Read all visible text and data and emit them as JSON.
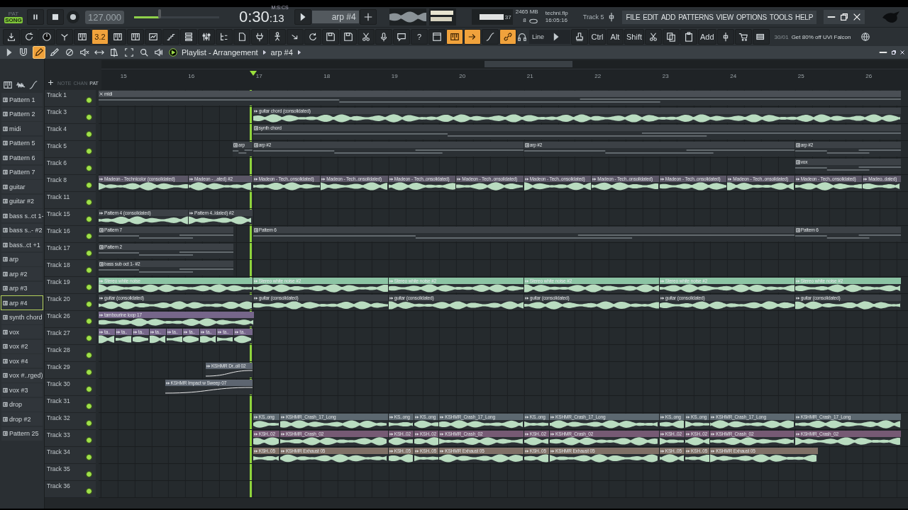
{
  "transport": {
    "modes": [
      {
        "label": "PAT",
        "selected": false
      },
      {
        "label": "SONG",
        "selected": true
      }
    ],
    "playing": true,
    "tempo": "127.000",
    "master_volume": {
      "level": 0.3
    },
    "time_format": "M:S:CS",
    "time": "0:30",
    "time_cs": ":13",
    "pattern": "arp #4"
  },
  "monitor": {
    "meter_reading": "37",
    "memory": "2465 MB",
    "cpu": "8",
    "file": "techni.flp",
    "clock": "16:05:16",
    "hint": "Track 5"
  },
  "menu": [
    "FILE",
    "EDIT",
    "ADD",
    "PATTERNS",
    "VIEW",
    "OPTIONS",
    "TOOLS",
    "HELP"
  ],
  "toolbar": {
    "buttons": [
      {
        "on": false
      },
      {
        "on": false
      },
      {
        "on": false
      },
      {
        "on": false
      },
      {
        "on": false
      },
      {
        "label": "3.2",
        "on": true
      },
      {
        "on": false
      },
      {
        "on": false
      },
      {
        "on": false
      },
      {
        "on": false
      },
      {
        "on": false
      },
      {
        "on": false
      },
      {
        "on": false
      },
      {
        "on": false
      },
      {
        "on": false
      },
      {
        "on": false
      },
      {
        "on": false
      },
      {
        "on": false
      },
      {
        "on": false
      },
      {
        "on": false
      },
      {
        "on": false
      },
      {
        "on": false
      },
      {
        "on": false
      },
      {
        "label": "?",
        "on": false
      },
      {
        "on": false
      },
      {
        "on": true
      },
      {
        "on": true
      },
      {
        "on": false
      },
      {
        "on": true
      }
    ],
    "snap_mode": "Line",
    "keys": [
      "Ctrl",
      "Alt",
      "Shift"
    ],
    "add": "Add",
    "news": {
      "date": "30/01",
      "text": "Get 80% off UVI Falcon"
    }
  },
  "playlist": {
    "tools": [
      {
        "on": false
      },
      {
        "on": true
      },
      {
        "on": false
      },
      {
        "on": false
      },
      {
        "on": false
      },
      {
        "on": false
      },
      {
        "on": false
      },
      {
        "on": false
      },
      {
        "on": false
      },
      {
        "on": false
      }
    ],
    "title": "Playlist - Arrangement",
    "pattern": "arp #4",
    "header_tabs": [
      {
        "label": "NOTE",
        "selected": false
      },
      {
        "label": "CHAN",
        "selected": false
      },
      {
        "label": "PAT",
        "selected": true
      }
    ],
    "ruler": [
      "15",
      "16",
      "17",
      "18",
      "19",
      "20",
      "21",
      "22",
      "23",
      "24",
      "25",
      "26"
    ]
  },
  "picker": [
    {
      "name": "Pattern 1",
      "selected": false
    },
    {
      "name": "Pattern 2",
      "selected": false
    },
    {
      "name": "midi",
      "selected": false
    },
    {
      "name": "Pattern 5",
      "selected": false
    },
    {
      "name": "Pattern 6",
      "selected": false
    },
    {
      "name": "Pattern 7",
      "selected": false
    },
    {
      "name": "guitar",
      "selected": false
    },
    {
      "name": "guitar #2",
      "selected": false
    },
    {
      "name": "bass s..ct 1-",
      "selected": false
    },
    {
      "name": "bass s..- #2",
      "selected": false
    },
    {
      "name": "bass..ct +1",
      "selected": false
    },
    {
      "name": "arp",
      "selected": false
    },
    {
      "name": "arp #2",
      "selected": false
    },
    {
      "name": "arp #3",
      "selected": false
    },
    {
      "name": "arp #4",
      "selected": true
    },
    {
      "name": "synth chord",
      "selected": false
    },
    {
      "name": "vox",
      "selected": false
    },
    {
      "name": "vox #2",
      "selected": false
    },
    {
      "name": "vox #4",
      "selected": false
    },
    {
      "name": "vox #..rged)",
      "selected": false
    },
    {
      "name": "vox #3",
      "selected": false
    },
    {
      "name": "drop",
      "selected": false
    },
    {
      "name": "drop #2",
      "selected": false
    },
    {
      "name": "Pattern 25",
      "selected": false
    }
  ],
  "tracks": [
    {
      "name": "Track 1",
      "enabled": true,
      "kind": "pattern",
      "color": "#4a4f55",
      "clips": [
        "midi"
      ]
    },
    {
      "name": "Track 3",
      "enabled": true,
      "kind": "audio",
      "color": "#3c4146",
      "clips": [
        "guitar chord (consolidated)"
      ]
    },
    {
      "name": "Track 4",
      "enabled": true,
      "kind": "pattern",
      "color": "#3c4146",
      "clips": [
        "synth chord"
      ]
    },
    {
      "name": "Track 5",
      "enabled": true,
      "kind": "pattern",
      "color": "#3c4146",
      "clips": [
        "arp",
        "arp #2",
        "arp #2",
        "arp #2"
      ]
    },
    {
      "name": "Track 6",
      "enabled": true,
      "kind": "pattern",
      "color": "#3c4146",
      "clips": [
        "vox"
      ]
    },
    {
      "name": "Track 8",
      "enabled": true,
      "kind": "audio",
      "color": "#5b5666",
      "clips": [
        "Madeon - Technicolor (consolidated)",
        "Madeon - ..ated) #2",
        "Madeon - Tech..onsolidated)",
        "Madeon - Tech..onsolidated)",
        "Madeon - Tech..onsolidated)",
        "Madeon - Tech..onsolidated)",
        "Madeon - Tech..onsolidated)",
        "Madeon - Tech..onsolidated)",
        "Madeon - Tech..onsolidated)",
        "Madeon - Tech..onsolidated)",
        "Madeon - Tech..onsolidated)",
        "Madeo..dated)"
      ]
    },
    {
      "name": "Track 11",
      "enabled": true
    },
    {
      "name": "Track 15",
      "enabled": true,
      "kind": "audio",
      "color": "#3c4146",
      "clips": [
        "Pattern 4 (consolidated)",
        "Pattern 4..idated) #2"
      ]
    },
    {
      "name": "Track 16",
      "enabled": true,
      "kind": "pattern",
      "color": "#3c4146",
      "clips": [
        "Pattern 7",
        "Pattern 6",
        "Pattern 6"
      ]
    },
    {
      "name": "Track 17",
      "enabled": true,
      "kind": "pattern",
      "color": "#3c4146",
      "clips": [
        "Pattern 2"
      ]
    },
    {
      "name": "Track 18",
      "enabled": true,
      "kind": "pattern",
      "color": "#3c4146",
      "clips": [
        "bass sub oct 1- #2"
      ]
    },
    {
      "name": "Track 19",
      "enabled": true,
      "kind": "audio",
      "color": "#8cc4a4",
      "clips": [
        "Stereo white noise",
        "Stereo white noise #2",
        "Stereo white noise #2",
        "Stereo white noise #2",
        "Stereo white noise #2",
        "Stereo white noise #2"
      ]
    },
    {
      "name": "Track 20",
      "enabled": true,
      "kind": "audio",
      "color": "#3c4146",
      "clips": [
        "guitar (consolidated)",
        "guitar (consolidated)",
        "guitar (consolidated)",
        "guitar (consolidated)",
        "guitar (consolidated)",
        "guitar (consolidated)"
      ]
    },
    {
      "name": "Track 26",
      "enabled": true,
      "kind": "audio",
      "color": "#76668a",
      "clips": [
        "tambourine loop 17"
      ]
    },
    {
      "name": "Track 27",
      "enabled": true,
      "kind": "audio",
      "color": "#76668a",
      "clips": [
        "ta..",
        "ta..",
        "ta..",
        "ta..",
        "ta..",
        "ta..",
        "ta..",
        "ta..",
        "ta.."
      ]
    },
    {
      "name": "Track 28",
      "enabled": true
    },
    {
      "name": "Track 29",
      "enabled": true,
      "kind": "automation",
      "color": "#5d6570",
      "clips": [
        "KSHMR Dr..oll 02"
      ]
    },
    {
      "name": "Track 30",
      "enabled": true,
      "kind": "automation",
      "color": "#5d6570",
      "clips": [
        "KSHMR Impact w Sweep 07"
      ]
    },
    {
      "name": "Track 31",
      "enabled": true
    },
    {
      "name": "Track 32",
      "enabled": true,
      "kind": "audio",
      "color": "#5c6870",
      "clips": [
        "KS..ong",
        "KSHMR_Crash_17_Long",
        "KS..ong",
        "KS..ong",
        "KSHMR_Crash_17_Long",
        "KS..ong",
        "KSHMR_Crash_17_Long",
        "KS..ong",
        "KS..ong",
        "KSHMR_Crash_17_Long",
        "KSHMR_Crash_17_Long"
      ]
    },
    {
      "name": "Track 33",
      "enabled": true,
      "kind": "audio",
      "color": "#765a74",
      "clips": [
        "KSH..02",
        "KSHMR_Crash_02",
        "KSH..02",
        "KSH..02",
        "KSHMR_Crash_02",
        "KSH..02",
        "KSHMR_Crash_02",
        "KSH..02",
        "KSH..02",
        "KSHMR_Crash_02",
        "KSHMR_Crash_02"
      ]
    },
    {
      "name": "Track 34",
      "enabled": true,
      "kind": "audio",
      "color": "#7f7066",
      "clips": [
        "KSH..05",
        "KSHMR Exhaust 05",
        "KSH..05",
        "KSH..05",
        "KSHMR Exhaust 05",
        "KSH..05",
        "KSHMR Exhaust 05",
        "KSH..05",
        "KSH..05",
        "KSHMR Exhaust 05"
      ]
    },
    {
      "name": "Track 35",
      "enabled": true
    },
    {
      "name": "Track 36",
      "enabled": true
    }
  ]
}
